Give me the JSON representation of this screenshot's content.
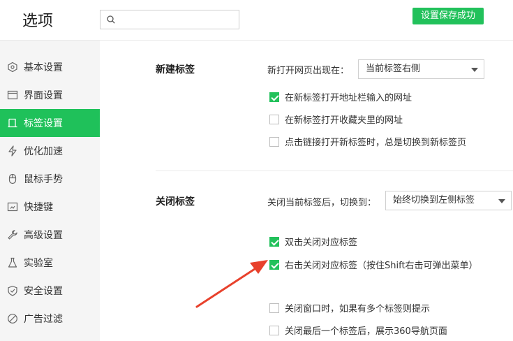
{
  "header": {
    "title": "选项",
    "search_placeholder": "",
    "save_status": "设置保存成功",
    "accent_color": "#22c15b"
  },
  "sidebar": {
    "items": [
      {
        "label": "基本设置",
        "icon": "hexagon-icon"
      },
      {
        "label": "界面设置",
        "icon": "window-icon"
      },
      {
        "label": "标签设置",
        "icon": "tab-icon",
        "active": true
      },
      {
        "label": "优化加速",
        "icon": "lightning-icon"
      },
      {
        "label": "鼠标手势",
        "icon": "mouse-icon"
      },
      {
        "label": "快捷键",
        "icon": "keyboard-icon"
      },
      {
        "label": "高级设置",
        "icon": "wrench-icon"
      },
      {
        "label": "实验室",
        "icon": "flask-icon"
      },
      {
        "label": "安全设置",
        "icon": "shield-icon"
      },
      {
        "label": "广告过滤",
        "icon": "block-icon"
      }
    ]
  },
  "new_tab": {
    "title": "新建标签",
    "open_label": "新打开网页出现在：",
    "open_select": "当前标签右侧",
    "options": [
      {
        "label": "在新标签打开地址栏输入的网址",
        "checked": true
      },
      {
        "label": "在新标签打开收藏夹里的网址",
        "checked": false
      },
      {
        "label": "点击链接打开新标签时，总是切换到新标签页",
        "checked": false
      }
    ]
  },
  "close_tab": {
    "title": "关闭标签",
    "switch_label": "关闭当前标签后，切换到：",
    "switch_select": "始终切换到左侧标签",
    "options": [
      {
        "label": "双击关闭对应标签",
        "checked": true
      },
      {
        "label": "右击关闭对应标签（按住Shift右击可弹出菜单）",
        "checked": true
      },
      {
        "label": "关闭窗口时，如果有多个标签则提示",
        "checked": false
      },
      {
        "label": "关闭最后一个标签后，展示360导航页面",
        "checked": false
      }
    ]
  },
  "annotation": {
    "arrow_color": "#e8412c"
  }
}
